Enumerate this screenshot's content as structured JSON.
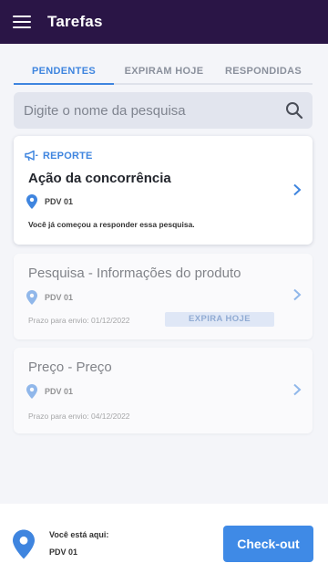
{
  "appbar": {
    "title": "Tarefas",
    "menu_icon": "hamburger-menu-icon"
  },
  "tabs": [
    {
      "label": "PENDENTES",
      "active": true
    },
    {
      "label": "EXPIRAM HOJE",
      "active": false
    },
    {
      "label": "RESPONDIDAS",
      "active": false
    }
  ],
  "search": {
    "placeholder": "Digite o nome da pesquisa",
    "value": "",
    "icon": "search-icon"
  },
  "cards": [
    {
      "tag": "REPORTE",
      "tag_icon": "megaphone-icon",
      "title": "Ação da concorrência",
      "pdv": "PDV 01",
      "note": "Você já começou a responder essa pesquisa."
    },
    {
      "title": "Pesquisa - Informações do produto",
      "pdv": "PDV 01",
      "deadline": "Prazo para envio: 01/12/2022",
      "badge": "EXPIRA HOJE"
    },
    {
      "title": "Preço - Preço",
      "pdv": "PDV 01",
      "deadline": "Prazo para envio: 04/12/2022"
    }
  ],
  "footer": {
    "location_label": "Você está aqui:",
    "location_value": "PDV 01",
    "checkout_label": "Check-out"
  },
  "colors": {
    "appbar": "#2a1546",
    "accent": "#3f85df",
    "checkout": "#3f8ae6",
    "background": "#f4f5f9"
  }
}
